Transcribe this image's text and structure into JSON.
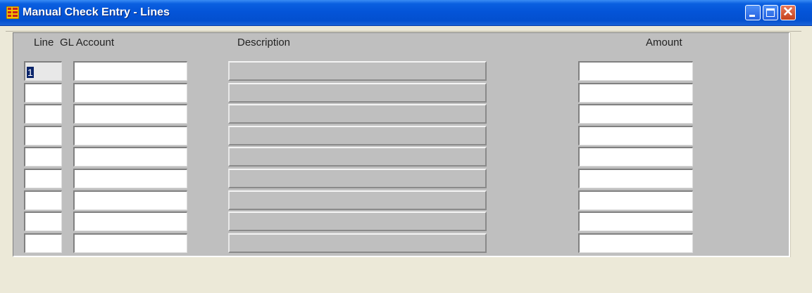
{
  "window": {
    "title": "Manual Check Entry - Lines",
    "icon": "form-grid-icon",
    "controls": [
      "minimize-icon",
      "maximize-icon",
      "close-icon"
    ]
  },
  "headers": {
    "line": "Line",
    "gl_account": "GL Account",
    "description": "Description",
    "amount": "Amount"
  },
  "rows": [
    {
      "line": "1",
      "gl_account": "",
      "description": "",
      "amount": ""
    },
    {
      "line": "",
      "gl_account": "",
      "description": "",
      "amount": ""
    },
    {
      "line": "",
      "gl_account": "",
      "description": "",
      "amount": ""
    },
    {
      "line": "",
      "gl_account": "",
      "description": "",
      "amount": ""
    },
    {
      "line": "",
      "gl_account": "",
      "description": "",
      "amount": ""
    },
    {
      "line": "",
      "gl_account": "",
      "description": "",
      "amount": ""
    },
    {
      "line": "",
      "gl_account": "",
      "description": "",
      "amount": ""
    },
    {
      "line": "",
      "gl_account": "",
      "description": "",
      "amount": ""
    },
    {
      "line": "",
      "gl_account": "",
      "description": "",
      "amount": ""
    }
  ],
  "colors": {
    "titlebar": "#0454d8",
    "panel": "#bfbfbf",
    "window_bg": "#ece9d8",
    "selection": "#0a246a"
  }
}
